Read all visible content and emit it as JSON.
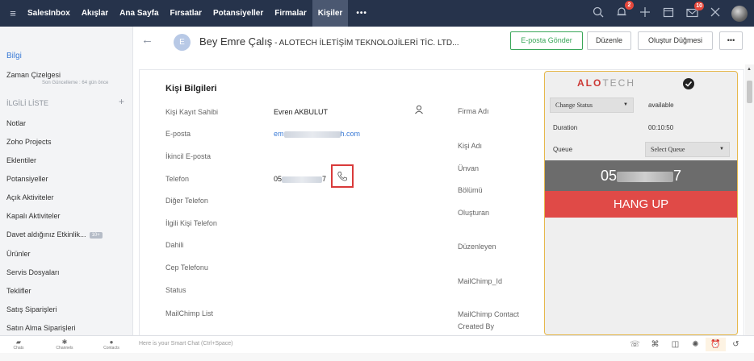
{
  "topnav": {
    "menu_icon": "hamburger-icon",
    "items": [
      "SalesInbox",
      "Akışlar",
      "Ana Sayfa",
      "Fırsatlar",
      "Potansiyeller",
      "Firmalar",
      "Kişiler"
    ],
    "active": "Kişiler",
    "more_label": "•••",
    "notification_badge": "2",
    "mail_badge": "10",
    "icons": [
      "search-icon",
      "bell-icon",
      "plus-icon",
      "calendar-icon",
      "mail-icon",
      "tools-icon",
      "avatar"
    ]
  },
  "sidebar": {
    "info": "Bilgi",
    "timeline": "Zaman Çizelgesi",
    "timeline_sub": "Son Güncelleme : 64 gün önce",
    "related_list": "İLGİLİ LİSTE",
    "items": [
      "Notlar",
      "Zoho Projects",
      "Eklentiler",
      "Potansiyeller",
      "Açık Aktiviteler",
      "Kapalı Aktiviteler",
      "Davet aldığınız Etkinlik...",
      "Ürünler",
      "Servis Dosyaları",
      "Teklifler",
      "Satış Siparişleri",
      "Satın Alma Siparişleri"
    ],
    "event_badge": "10+"
  },
  "header": {
    "avatar_letter": "E",
    "title": "Bey Emre Çalış",
    "company": " - ALOTECH İLETİŞİM TEKNOLOJİLERİ TİC. LTD...",
    "send_email": "E-posta Gönder",
    "edit": "Düzenle",
    "create_button": "Oluştur Düğmesi",
    "more": "•••"
  },
  "main": {
    "section_title": "Kişi Bilgileri",
    "fields": [
      {
        "label": "Kişi Kayıt Sahibi",
        "value": "Evren AKBULUT"
      },
      {
        "label": "E-posta",
        "value_prefix": "em",
        "value_suffix": "h.com"
      },
      {
        "label": "İkincil E-posta",
        "value": ""
      },
      {
        "label": "Telefon",
        "value_prefix": "05",
        "value_suffix": "7"
      },
      {
        "label": "Diğer Telefon",
        "value": ""
      },
      {
        "label": "İlgili Kişi Telefon",
        "value": ""
      },
      {
        "label": "Dahili",
        "value": ""
      },
      {
        "label": "Cep Telefonu",
        "value": ""
      },
      {
        "label": "Status",
        "value": ""
      },
      {
        "label": "MailChimp List",
        "value": ""
      }
    ],
    "right_labels": [
      "Firma Adı",
      "Kişi Adı",
      "Ünvan",
      "Bölümü",
      "Oluşturan",
      "Düzenleyen",
      "MailChimp_Id",
      "MailChimp Contact",
      "Created By"
    ]
  },
  "widget": {
    "logo_red": "ALO",
    "logo_gray": "TECH",
    "change_status": "Change Status",
    "status_value": "available",
    "duration_label": "Duration",
    "duration_value": "00:10:50",
    "queue_label": "Queue",
    "queue_select": "Select Queue",
    "number_prefix": "05",
    "number_suffix": "7",
    "hangup": "HANG UP"
  },
  "bottombar": {
    "tabs": [
      "Chats",
      "Channels",
      "Contacts"
    ],
    "chat_placeholder": "Here is your Smart Chat (Ctrl+Space)",
    "icons": [
      "phone-icon",
      "gamepad-icon",
      "cube-icon",
      "bulb-icon",
      "alarm-icon",
      "clock-back-icon"
    ]
  },
  "colors": {
    "nav_bg": "#26334b",
    "accent_blue": "#3b7bd6",
    "green": "#39a659",
    "hangup_red": "#e04a47",
    "widget_border": "#e6b84b"
  }
}
